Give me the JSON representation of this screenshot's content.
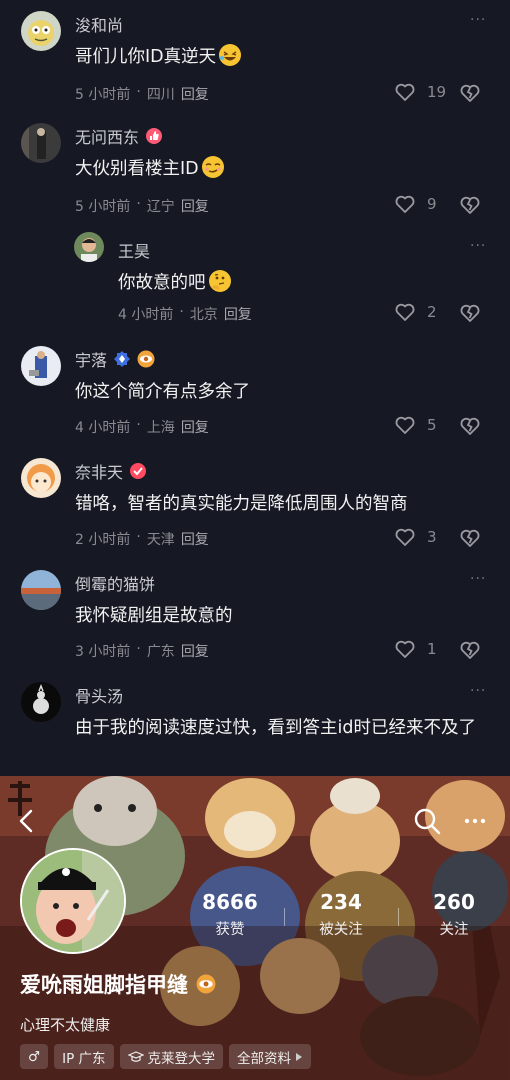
{
  "comments": [
    {
      "name": "浚和尚",
      "text": "哥们儿你ID真逆天",
      "time": "5 小时前",
      "location": "四川",
      "reply": "回复",
      "likes": "19"
    },
    {
      "name": "无问西东",
      "text": "大伙别看楼主ID",
      "time": "5 小时前",
      "location": "辽宁",
      "reply": "回复",
      "likes": "9"
    },
    {
      "name": "王昊",
      "text": "你故意的吧",
      "time": "4 小时前",
      "location": "北京",
      "reply": "回复",
      "likes": "2"
    },
    {
      "name": "宇落",
      "text": "你这个简介有点多余了",
      "time": "4 小时前",
      "location": "上海",
      "reply": "回复",
      "likes": "5"
    },
    {
      "name": "奈非天",
      "text": "错咯，智者的真实能力是降低周围人的智商",
      "time": "2 小时前",
      "location": "天津",
      "reply": "回复",
      "likes": "3"
    },
    {
      "name": "倒霉的猫饼",
      "text": "我怀疑剧组是故意的",
      "time": "3 小时前",
      "location": "广东",
      "reply": "回复",
      "likes": "1"
    },
    {
      "name": "骨头汤",
      "text": "由于我的阅读速度过快，看到答主id时已经来不及了"
    }
  ],
  "meta_sep": "·",
  "more": "···",
  "profile": {
    "name": "爱吮雨姐脚指甲缝",
    "bio": "心理不太健康",
    "stats": [
      {
        "num": "8666",
        "label": "获赞"
      },
      {
        "num": "234",
        "label": "被关注"
      },
      {
        "num": "260",
        "label": "关注"
      }
    ],
    "tags": {
      "gender": "♂",
      "ip": "IP 广东",
      "school": "克莱登大学",
      "all": "全部资料"
    }
  },
  "colors": {
    "bg": "#161823",
    "meta": "#8a8b91",
    "profile_bg": "#5b2a24"
  }
}
